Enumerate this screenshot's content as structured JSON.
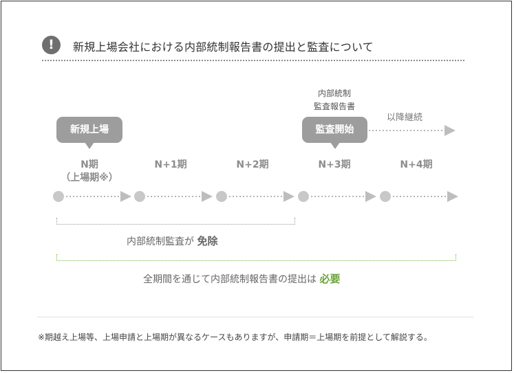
{
  "header": {
    "alert_icon_glyph": "!",
    "title": "新規上場会社における内部統制報告書の提出と監査について"
  },
  "bubbles": {
    "listing": "新規上場",
    "audit_start": "監査開始"
  },
  "notes": {
    "report_line1": "内部統制",
    "report_line2": "監査報告書",
    "continue": "以降継続"
  },
  "periods": [
    {
      "label": "N期",
      "sub": "（上場期※）"
    },
    {
      "label": "N+1期"
    },
    {
      "label": "N+2期"
    },
    {
      "label": "N+3期"
    },
    {
      "label": "N+4期"
    }
  ],
  "captions": {
    "exempt_prefix": "内部統制監査が",
    "exempt_value": "免除",
    "required_prefix": "全期間を通じて内部統制報告書の提出は",
    "required_value": "必要"
  },
  "footnote": "※期越え上場等、上場申請と上場期が異なるケースもありますが、申請期＝上場期を前提として解説する。",
  "colors": {
    "dot": "#c8c8c8",
    "arrow": "#bdbdbd",
    "bubble": "#9d9d9d",
    "accent_green": "#6aa339"
  }
}
